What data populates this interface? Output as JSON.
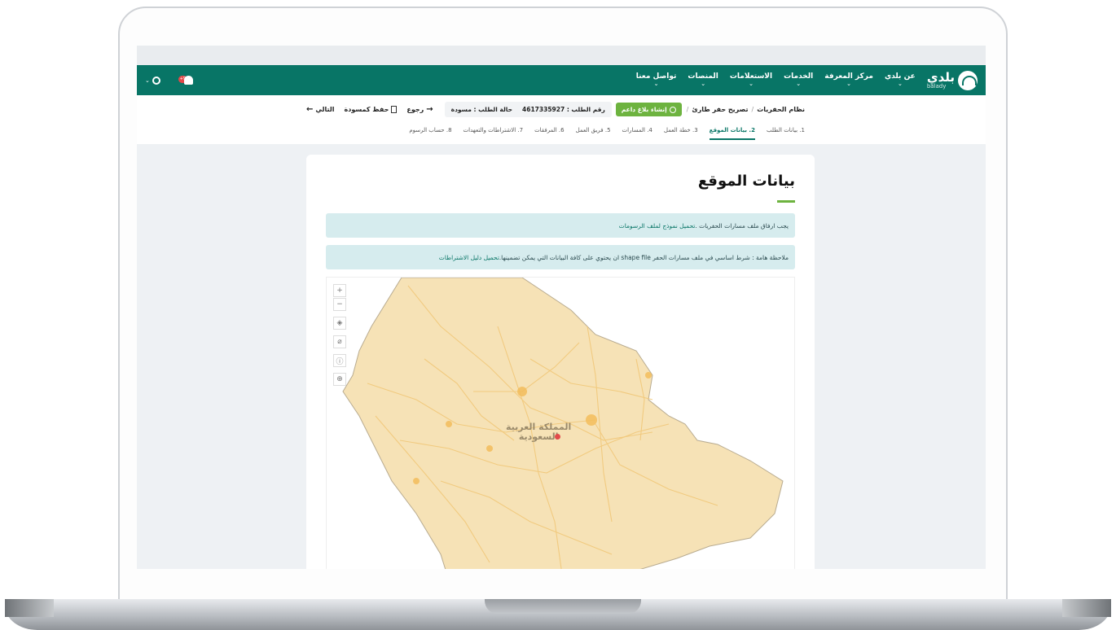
{
  "nav": {
    "brand_ar": "بلدي",
    "brand_en": "balady",
    "items": [
      {
        "label": "عن بلدي"
      },
      {
        "label": "مركز المعرفة"
      },
      {
        "label": "الخدمات"
      },
      {
        "label": "الاستعلامات"
      },
      {
        "label": "المنصات"
      },
      {
        "label": "تواصل معنا"
      }
    ],
    "notification_count": "+9"
  },
  "breadcrumb": {
    "root": "نظام الحفريات",
    "current": "تصريح حفر طارئ"
  },
  "report_button": "إنشاء بلاغ داعم",
  "request": {
    "number_label": "رقم الطلب : 4617335927",
    "status_label": "حالة الطلب : مسودة"
  },
  "actions": {
    "back": "رجوع",
    "save_draft": "حفظ كمسودة",
    "next": "التالي"
  },
  "steps": [
    {
      "label": "1. بيانات الطلب",
      "active": false
    },
    {
      "label": "2. بيانات الموقع",
      "active": true
    },
    {
      "label": "3. خطة العمل",
      "active": false
    },
    {
      "label": "4. المسارات",
      "active": false
    },
    {
      "label": "5. فريق العمل",
      "active": false
    },
    {
      "label": "6. المرفقات",
      "active": false
    },
    {
      "label": "7. الاشتراطات والتعهدات",
      "active": false
    },
    {
      "label": "8. حساب الرسوم",
      "active": false
    }
  ],
  "page": {
    "title": "بيانات الموقع",
    "alert1_text": "يجب ارفاق ملف مسارات الحفريات . ",
    "alert1_link": "تحميل نموذج لملف الرسومات",
    "alert2_text": "ملاحظة هامة : شرط اساسي في ملف مسارات الحفر shape file ان يحتوي على كافة البيانات التي يمكن تضمينها. ",
    "alert2_link": "تحميل دليل الاشتراطات"
  },
  "map": {
    "label_line1": "المملكة العربية",
    "label_line2": "السعودية",
    "land_color": "#f6e2b6",
    "road_color": "#f1c87a",
    "controls": [
      "zoom-in-icon",
      "zoom-out-icon",
      "layers-icon",
      "attach-icon",
      "info-icon",
      "locate-icon"
    ]
  },
  "colors": {
    "primary": "#087566",
    "accent": "#6db33f",
    "alert_bg": "#d6ecee"
  }
}
